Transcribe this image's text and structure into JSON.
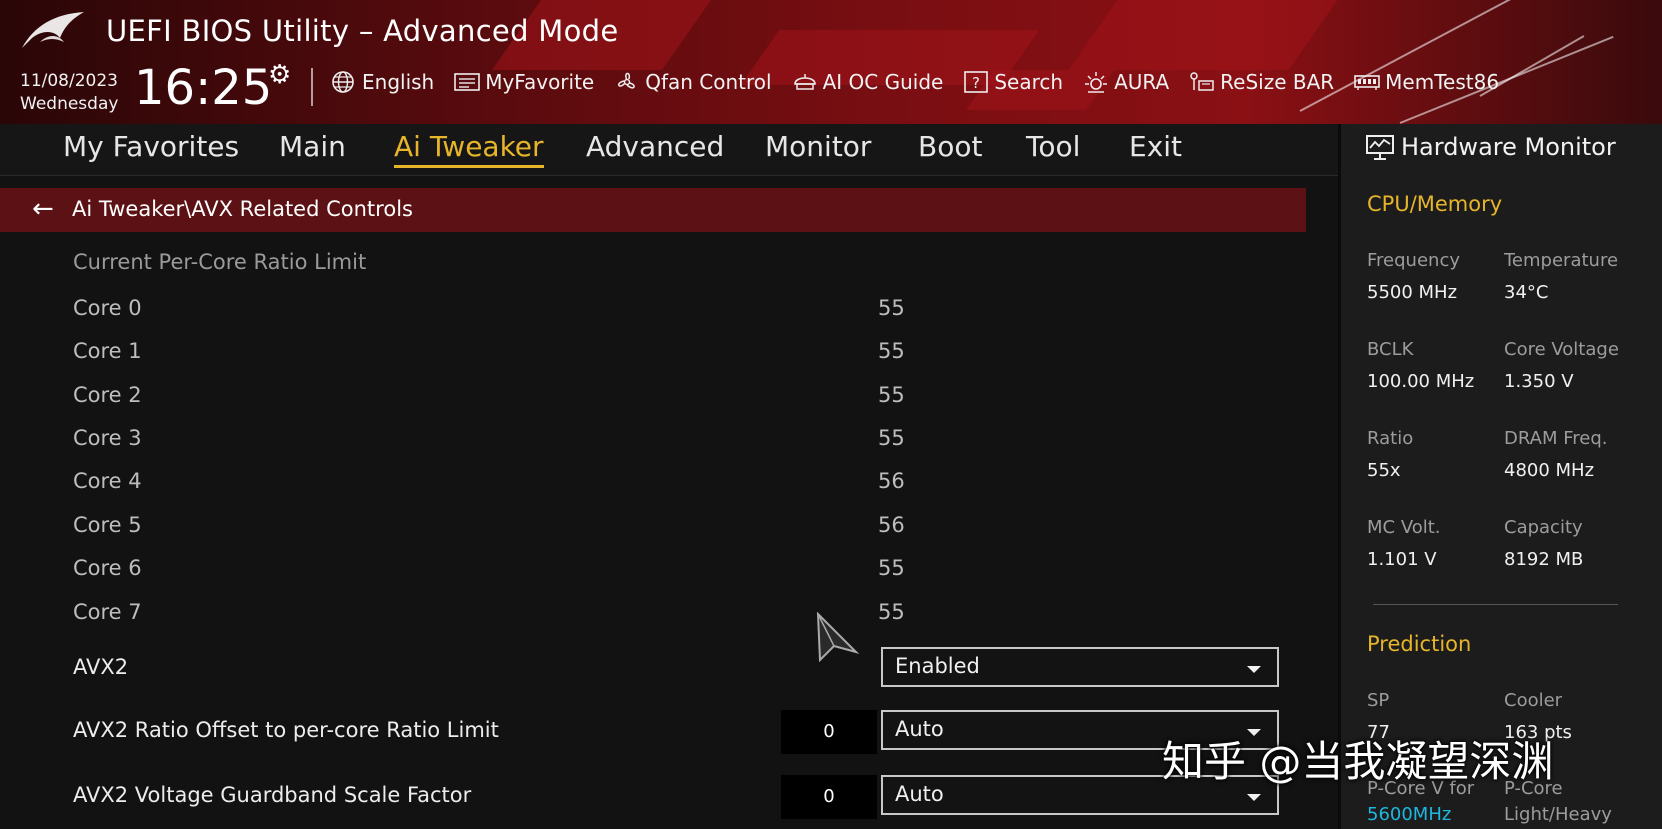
{
  "header": {
    "title": "UEFI BIOS Utility – Advanced Mode",
    "date": "11/08/2023",
    "weekday": "Wednesday",
    "time": "16:25",
    "tools": [
      {
        "icon": "globe-icon",
        "label": "English"
      },
      {
        "icon": "favorite-list-icon",
        "label": "MyFavorite"
      },
      {
        "icon": "fan-icon",
        "label": "Qfan Control"
      },
      {
        "icon": "ai-oc-guide-icon",
        "label": "AI OC Guide"
      },
      {
        "icon": "search-help-icon",
        "label": "Search"
      },
      {
        "icon": "aura-light-icon",
        "label": "AURA"
      },
      {
        "icon": "resize-bar-icon",
        "label": "ReSize BAR"
      },
      {
        "icon": "memory-icon",
        "label": "MemTest86"
      }
    ]
  },
  "tabs": [
    "My Favorites",
    "Main",
    "Ai Tweaker",
    "Advanced",
    "Monitor",
    "Boot",
    "Tool",
    "Exit"
  ],
  "active_tab": "Ai Tweaker",
  "breadcrumb": "Ai Tweaker\\AVX Related Controls",
  "content": {
    "section_title": "Current Per-Core Ratio Limit",
    "cores": [
      {
        "label": "Core 0",
        "value": "55"
      },
      {
        "label": "Core 1",
        "value": "55"
      },
      {
        "label": "Core 2",
        "value": "55"
      },
      {
        "label": "Core 3",
        "value": "55"
      },
      {
        "label": "Core 4",
        "value": "56"
      },
      {
        "label": "Core 5",
        "value": "56"
      },
      {
        "label": "Core 6",
        "value": "55"
      },
      {
        "label": "Core 7",
        "value": "55"
      }
    ],
    "options": [
      {
        "label": "AVX2",
        "value": "Enabled",
        "number": ""
      },
      {
        "label": "AVX2 Ratio Offset to per-core Ratio Limit",
        "value": "Auto",
        "number": "0"
      },
      {
        "label": "AVX2 Voltage Guardband Scale Factor",
        "value": "Auto",
        "number": "0"
      }
    ]
  },
  "hardware_monitor": {
    "title": "Hardware Monitor",
    "cpu_memory": {
      "title": "CPU/Memory",
      "items": [
        {
          "label": "Frequency",
          "value": "5500 MHz"
        },
        {
          "label": "Temperature",
          "value": "34°C"
        },
        {
          "label": "BCLK",
          "value": "100.00 MHz"
        },
        {
          "label": "Core Voltage",
          "value": "1.350 V"
        },
        {
          "label": "Ratio",
          "value": "55x"
        },
        {
          "label": "DRAM Freq.",
          "value": "4800 MHz"
        },
        {
          "label": "MC Volt.",
          "value": "1.101 V"
        },
        {
          "label": "Capacity",
          "value": "8192 MB"
        }
      ]
    },
    "prediction": {
      "title": "Prediction",
      "items": [
        {
          "label": "SP",
          "value": "77"
        },
        {
          "label": "Cooler",
          "value": "163 pts"
        },
        {
          "label": "P-Core V for",
          "value": "5600MHz"
        },
        {
          "label": "P-Core",
          "value": "Light/Heavy"
        }
      ]
    }
  },
  "watermark": "知乎 @当我凝望深渊",
  "colors": {
    "accent": "#e7b52a",
    "breadcrumb_bg": "#5c1214",
    "cyan_value": "#1fb7e0"
  }
}
